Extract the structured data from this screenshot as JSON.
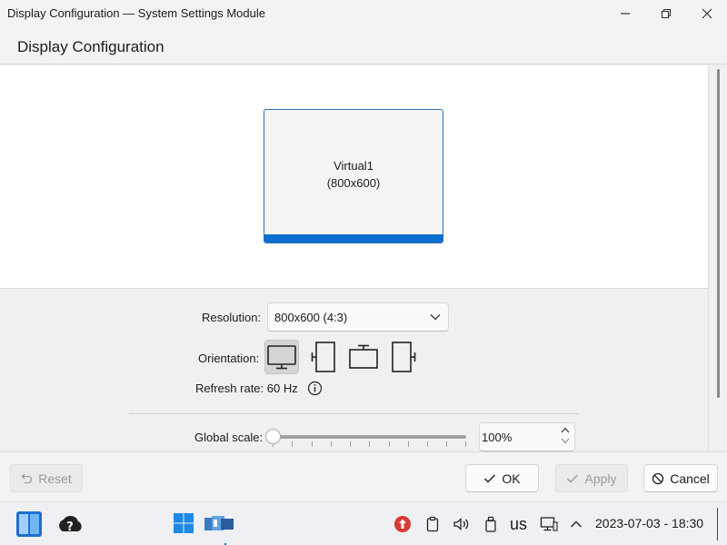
{
  "window": {
    "title": "Display Configuration — System Settings Module"
  },
  "header": {
    "title": "Display Configuration"
  },
  "preview": {
    "monitor_name": "Virtual1",
    "monitor_resolution": "(800x600)"
  },
  "settings": {
    "resolution_label": "Resolution:",
    "resolution_value": "800x600 (4:3)",
    "orientation_label": "Orientation:",
    "orientation_options": [
      "landscape",
      "portrait",
      "landscape-flipped",
      "portrait-flipped"
    ],
    "orientation_selected": "landscape",
    "refresh_rate_label": "Refresh rate: 60 Hz",
    "global_scale_label": "Global scale:",
    "global_scale_value": "100%",
    "global_scale_slider_fraction": 0.0
  },
  "footer": {
    "reset_label": "Reset",
    "ok_label": "OK",
    "apply_label": "Apply",
    "cancel_label": "Cancel"
  },
  "taskbar": {
    "keyboard_layout": "us",
    "datetime": "2023-07-03 - 18:30"
  },
  "colors": {
    "accent": "#0a6fd0",
    "update_badge": "#d83b30"
  }
}
